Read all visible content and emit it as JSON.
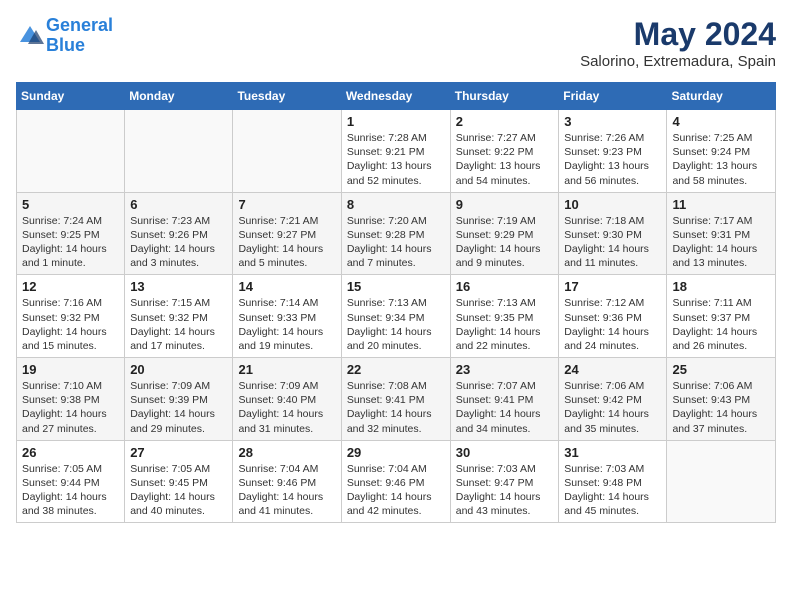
{
  "header": {
    "logo_line1": "General",
    "logo_line2": "Blue",
    "month": "May 2024",
    "location": "Salorino, Extremadura, Spain"
  },
  "weekdays": [
    "Sunday",
    "Monday",
    "Tuesday",
    "Wednesday",
    "Thursday",
    "Friday",
    "Saturday"
  ],
  "weeks": [
    [
      {
        "day": "",
        "info": ""
      },
      {
        "day": "",
        "info": ""
      },
      {
        "day": "",
        "info": ""
      },
      {
        "day": "1",
        "info": "Sunrise: 7:28 AM\nSunset: 9:21 PM\nDaylight: 13 hours\nand 52 minutes."
      },
      {
        "day": "2",
        "info": "Sunrise: 7:27 AM\nSunset: 9:22 PM\nDaylight: 13 hours\nand 54 minutes."
      },
      {
        "day": "3",
        "info": "Sunrise: 7:26 AM\nSunset: 9:23 PM\nDaylight: 13 hours\nand 56 minutes."
      },
      {
        "day": "4",
        "info": "Sunrise: 7:25 AM\nSunset: 9:24 PM\nDaylight: 13 hours\nand 58 minutes."
      }
    ],
    [
      {
        "day": "5",
        "info": "Sunrise: 7:24 AM\nSunset: 9:25 PM\nDaylight: 14 hours\nand 1 minute."
      },
      {
        "day": "6",
        "info": "Sunrise: 7:23 AM\nSunset: 9:26 PM\nDaylight: 14 hours\nand 3 minutes."
      },
      {
        "day": "7",
        "info": "Sunrise: 7:21 AM\nSunset: 9:27 PM\nDaylight: 14 hours\nand 5 minutes."
      },
      {
        "day": "8",
        "info": "Sunrise: 7:20 AM\nSunset: 9:28 PM\nDaylight: 14 hours\nand 7 minutes."
      },
      {
        "day": "9",
        "info": "Sunrise: 7:19 AM\nSunset: 9:29 PM\nDaylight: 14 hours\nand 9 minutes."
      },
      {
        "day": "10",
        "info": "Sunrise: 7:18 AM\nSunset: 9:30 PM\nDaylight: 14 hours\nand 11 minutes."
      },
      {
        "day": "11",
        "info": "Sunrise: 7:17 AM\nSunset: 9:31 PM\nDaylight: 14 hours\nand 13 minutes."
      }
    ],
    [
      {
        "day": "12",
        "info": "Sunrise: 7:16 AM\nSunset: 9:32 PM\nDaylight: 14 hours\nand 15 minutes."
      },
      {
        "day": "13",
        "info": "Sunrise: 7:15 AM\nSunset: 9:32 PM\nDaylight: 14 hours\nand 17 minutes."
      },
      {
        "day": "14",
        "info": "Sunrise: 7:14 AM\nSunset: 9:33 PM\nDaylight: 14 hours\nand 19 minutes."
      },
      {
        "day": "15",
        "info": "Sunrise: 7:13 AM\nSunset: 9:34 PM\nDaylight: 14 hours\nand 20 minutes."
      },
      {
        "day": "16",
        "info": "Sunrise: 7:13 AM\nSunset: 9:35 PM\nDaylight: 14 hours\nand 22 minutes."
      },
      {
        "day": "17",
        "info": "Sunrise: 7:12 AM\nSunset: 9:36 PM\nDaylight: 14 hours\nand 24 minutes."
      },
      {
        "day": "18",
        "info": "Sunrise: 7:11 AM\nSunset: 9:37 PM\nDaylight: 14 hours\nand 26 minutes."
      }
    ],
    [
      {
        "day": "19",
        "info": "Sunrise: 7:10 AM\nSunset: 9:38 PM\nDaylight: 14 hours\nand 27 minutes."
      },
      {
        "day": "20",
        "info": "Sunrise: 7:09 AM\nSunset: 9:39 PM\nDaylight: 14 hours\nand 29 minutes."
      },
      {
        "day": "21",
        "info": "Sunrise: 7:09 AM\nSunset: 9:40 PM\nDaylight: 14 hours\nand 31 minutes."
      },
      {
        "day": "22",
        "info": "Sunrise: 7:08 AM\nSunset: 9:41 PM\nDaylight: 14 hours\nand 32 minutes."
      },
      {
        "day": "23",
        "info": "Sunrise: 7:07 AM\nSunset: 9:41 PM\nDaylight: 14 hours\nand 34 minutes."
      },
      {
        "day": "24",
        "info": "Sunrise: 7:06 AM\nSunset: 9:42 PM\nDaylight: 14 hours\nand 35 minutes."
      },
      {
        "day": "25",
        "info": "Sunrise: 7:06 AM\nSunset: 9:43 PM\nDaylight: 14 hours\nand 37 minutes."
      }
    ],
    [
      {
        "day": "26",
        "info": "Sunrise: 7:05 AM\nSunset: 9:44 PM\nDaylight: 14 hours\nand 38 minutes."
      },
      {
        "day": "27",
        "info": "Sunrise: 7:05 AM\nSunset: 9:45 PM\nDaylight: 14 hours\nand 40 minutes."
      },
      {
        "day": "28",
        "info": "Sunrise: 7:04 AM\nSunset: 9:46 PM\nDaylight: 14 hours\nand 41 minutes."
      },
      {
        "day": "29",
        "info": "Sunrise: 7:04 AM\nSunset: 9:46 PM\nDaylight: 14 hours\nand 42 minutes."
      },
      {
        "day": "30",
        "info": "Sunrise: 7:03 AM\nSunset: 9:47 PM\nDaylight: 14 hours\nand 43 minutes."
      },
      {
        "day": "31",
        "info": "Sunrise: 7:03 AM\nSunset: 9:48 PM\nDaylight: 14 hours\nand 45 minutes."
      },
      {
        "day": "",
        "info": ""
      }
    ]
  ]
}
